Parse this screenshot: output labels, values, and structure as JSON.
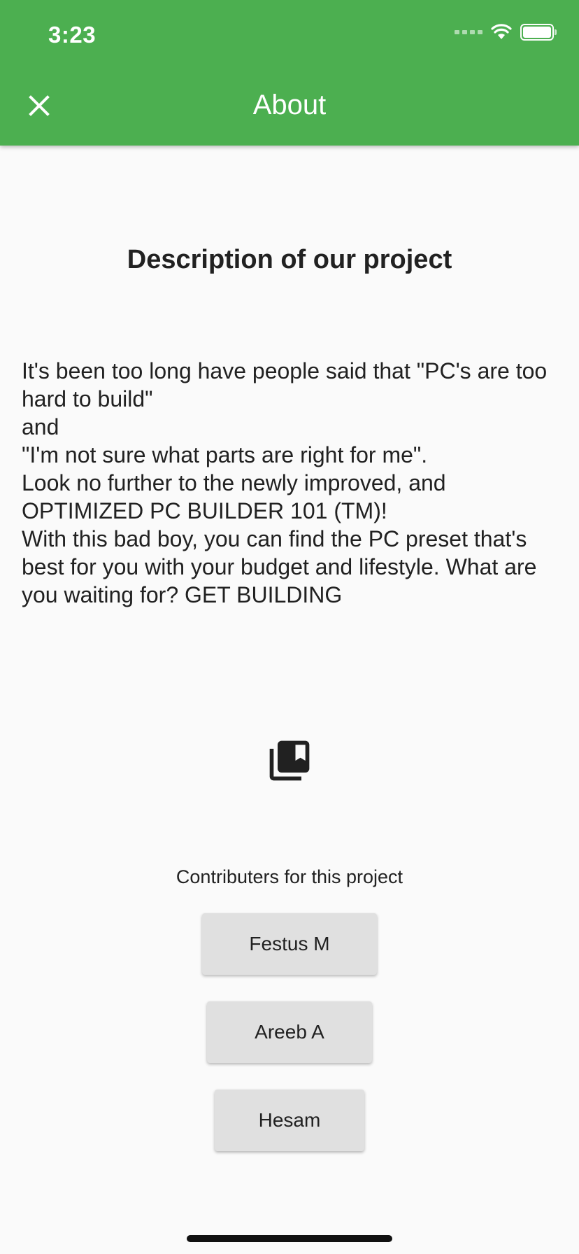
{
  "status_bar": {
    "time": "3:23"
  },
  "appbar": {
    "title": "About",
    "close_icon": "close-icon"
  },
  "main": {
    "heading": "Description of our project",
    "description": "It's been too long have people said that \"PC's are too hard to build\"\nand\n\"I'm not sure what parts are right for me\".\nLook no further to the newly improved, and OPTIMIZED PC BUILDER 101 (TM)!\nWith this bad boy, you can find the PC preset that's best for you with your budget and lifestyle. What are you waiting for? GET BUILDING",
    "icon": "collections-bookmark-icon",
    "contributors_label": "Contributers for this project",
    "contributors": [
      "Festus M",
      "Areeb A",
      "Hesam"
    ]
  },
  "colors": {
    "accent": "#4caf50",
    "button_bg": "#e0e0e0",
    "background": "#fafafa"
  }
}
